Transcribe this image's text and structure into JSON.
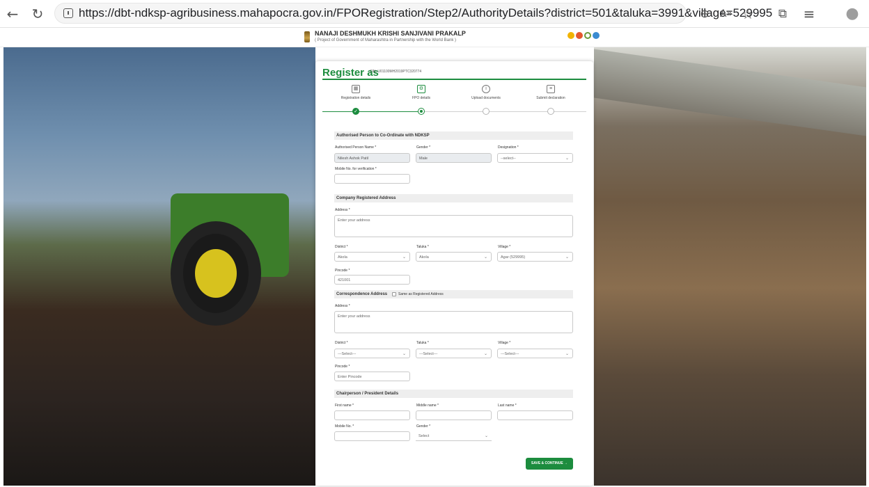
{
  "browser": {
    "url": "https://dbt-ndksp-agribusiness.mahapocra.gov.in/FPORegistration/Step2/AuthorityDetails?district=501&taluka=3991&village=529995",
    "icons": {
      "back": "←",
      "reload": "↻",
      "zoom": "⊖",
      "read_aloud": "A»",
      "favorite": "☆",
      "extensions": "⧉",
      "favorites_bar": "≡",
      "profile": "●"
    }
  },
  "site": {
    "title": "NANAJI DESHMUKH KRISHI SANJIVANI PRAKALP",
    "subtitle": "( Project of Government of Maharashtra in Partnership with the World Bank )"
  },
  "form": {
    "title": "Register as",
    "cin": "CIN: U01100MH2019PTC320774",
    "steps": [
      {
        "label": "Registration details",
        "state": "done"
      },
      {
        "label": "FPO details",
        "state": "current"
      },
      {
        "label": "Upload documents",
        "state": "todo"
      },
      {
        "label": "Submit declaration",
        "state": "todo"
      }
    ],
    "authorised": {
      "heading": "Authorised Person to Co-Ordinate with NDKSP",
      "name_label": "Authorised Person Name *",
      "name_value": "Nilesh Ashok Patil",
      "gender_label": "Gender *",
      "gender_value": "Male",
      "designation_label": "Designation *",
      "designation_value": "--select--",
      "mobile_label": "Mobile No. for verification *",
      "mobile_value": ""
    },
    "registered": {
      "heading": "Company Registered Address",
      "address_label": "Address *",
      "address_placeholder": "Enter your address",
      "district_label": "District *",
      "district_value": "Akola",
      "taluka_label": "Taluka *",
      "taluka_value": "Akola",
      "village_label": "Village *",
      "village_value": "Agar (529995)",
      "pincode_label": "Pincode *",
      "pincode_value": "421001"
    },
    "correspondence": {
      "heading": "Correspondence Address",
      "same_label": "Same as Registered Address",
      "address_label": "Address *",
      "address_placeholder": "Enter your address",
      "district_label": "District *",
      "district_value": "---Select---",
      "taluka_label": "Taluka *",
      "taluka_value": "---Select---",
      "village_label": "Village *",
      "village_value": "---Select---",
      "pincode_label": "Pincode *",
      "pincode_placeholder": "Enter Pincode"
    },
    "chairperson": {
      "heading": "Chairperson / President Details",
      "first_label": "First name *",
      "middle_label": "Middle name *",
      "last_label": "Last name *",
      "mobile_label": "Mobile No. *",
      "gender_label": "Gender *",
      "gender_value": "Select"
    },
    "save_label": "SAVE & CONTINUE  →"
  },
  "colors": {
    "accent": "#1c8c3e"
  }
}
